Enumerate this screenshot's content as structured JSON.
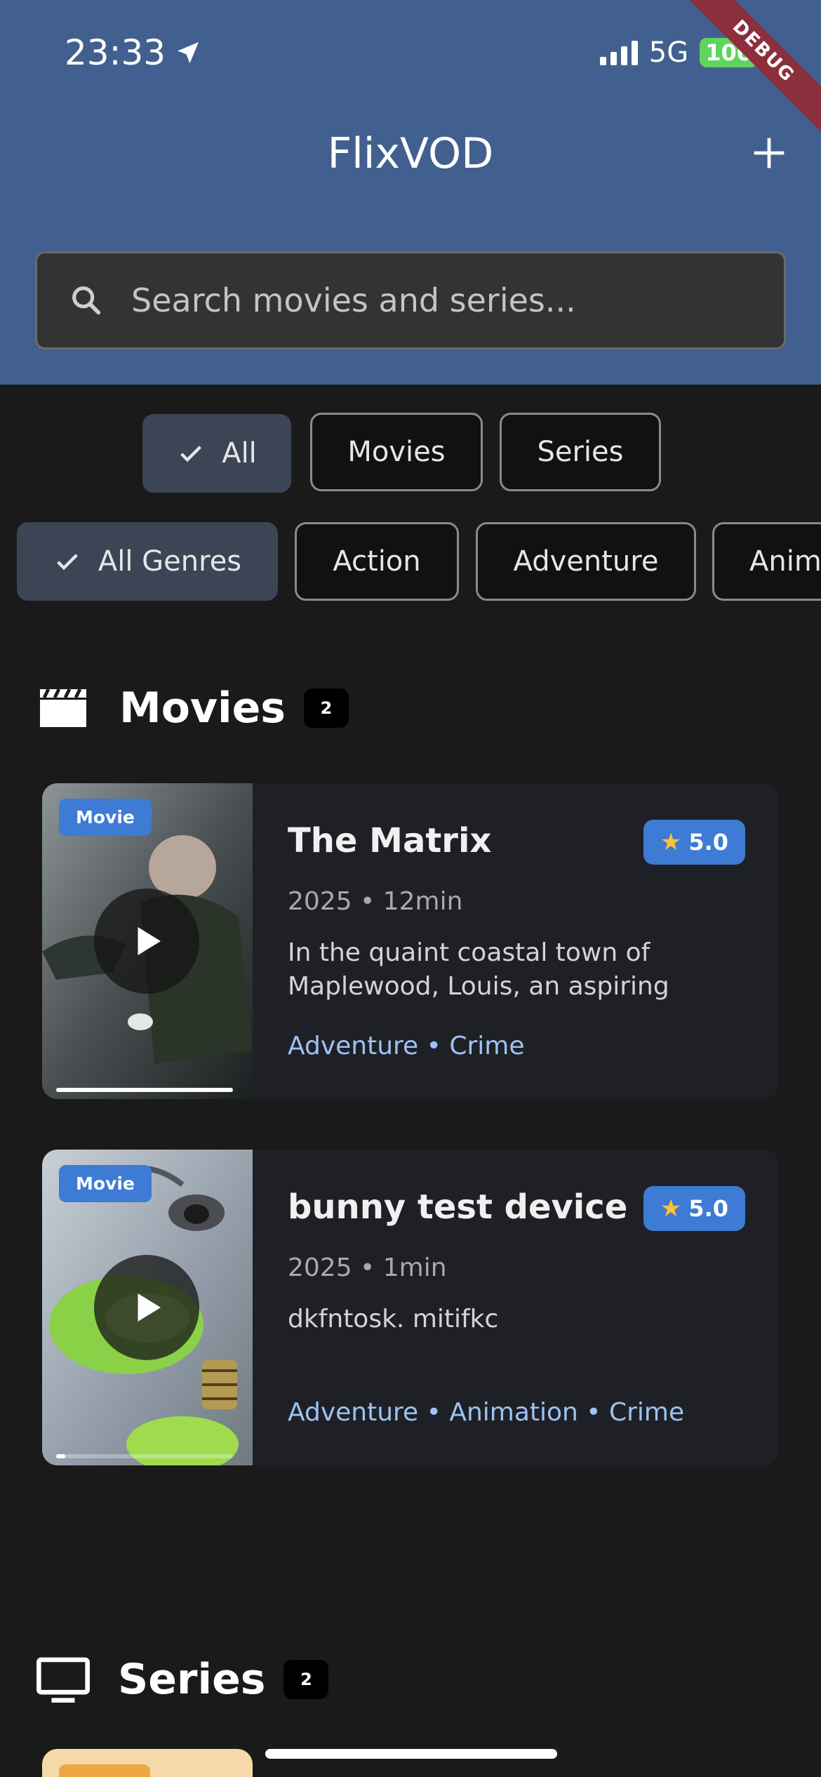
{
  "status": {
    "time": "23:33",
    "network": "5G",
    "battery": "100",
    "debug": "DEBUG"
  },
  "header": {
    "title": "FlixVOD"
  },
  "search": {
    "placeholder": "Search movies and series..."
  },
  "type_filters": [
    {
      "label": "All",
      "selected": true
    },
    {
      "label": "Movies",
      "selected": false
    },
    {
      "label": "Series",
      "selected": false
    }
  ],
  "genre_filters": [
    {
      "label": "All Genres",
      "selected": true
    },
    {
      "label": "Action",
      "selected": false
    },
    {
      "label": "Adventure",
      "selected": false
    },
    {
      "label": "Anim",
      "selected": false
    }
  ],
  "movies_section": {
    "title": "Movies",
    "count": "2"
  },
  "movies": [
    {
      "type": "Movie",
      "title": "The Matrix",
      "rating": "5.0",
      "meta": "2025 • 12min",
      "description": "In the quaint coastal town of Maplewood, Louis, an aspiring author burdened by writer's block",
      "genres": "Adventure • Crime",
      "progress": 1.0
    },
    {
      "type": "Movie",
      "title": "bunny test device",
      "rating": "5.0",
      "meta": "2025 • 1min",
      "description": "dkfntosk. mitifkc",
      "genres": "Adventure • Animation • Crime",
      "progress": 0.05
    }
  ],
  "series_section": {
    "title": "Series",
    "count": "2"
  },
  "colors": {
    "header": "#41608f",
    "accent": "#3d7bd4",
    "background": "#1a1a1b",
    "genre_text": "#9ec2f4"
  }
}
